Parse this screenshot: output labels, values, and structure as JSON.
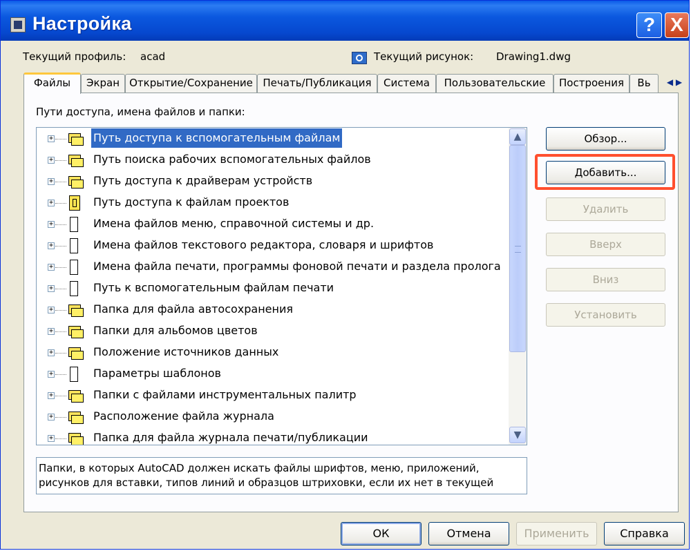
{
  "window": {
    "title": "Настройка",
    "help_label": "?",
    "close_label": "X"
  },
  "profile": {
    "current_profile_label": "Текущий профиль:",
    "current_profile_value": "acad",
    "current_drawing_label": "Текущий рисунок:",
    "current_drawing_value": "Drawing1.dwg"
  },
  "tabs": [
    {
      "label": "Файлы",
      "active": true
    },
    {
      "label": "Экран"
    },
    {
      "label": "Открытие/Сохранение"
    },
    {
      "label": "Печать/Публикация"
    },
    {
      "label": "Система"
    },
    {
      "label": "Пользовательские"
    },
    {
      "label": "Построения"
    },
    {
      "label": "Вь"
    }
  ],
  "tab_scroll": {
    "left": "◀",
    "right": "▶"
  },
  "files_panel": {
    "label": "Пути доступа, имена файлов и папки:",
    "tree_items": [
      {
        "label": "Путь доступа к вспомогательным файлам",
        "icon": "folder-icon",
        "selected": true
      },
      {
        "label": "Путь поиска рабочих вспомогательных файлов",
        "icon": "folder-icon"
      },
      {
        "label": "Путь доступа к драйверам устройств",
        "icon": "folder-icon"
      },
      {
        "label": "Путь доступа к файлам проектов",
        "icon": "project-icon"
      },
      {
        "label": "Имена файлов меню, справочной системы и др.",
        "icon": "document-icon"
      },
      {
        "label": "Имена файлов текстового редактора, словаря и шрифтов",
        "icon": "document-icon"
      },
      {
        "label": "Имена файла печати, программы фоновой печати и раздела пролога",
        "icon": "document-icon"
      },
      {
        "label": "Путь к вспомогательным файлам печати",
        "icon": "document-icon"
      },
      {
        "label": "Папка для файла автосохранения",
        "icon": "folder-icon"
      },
      {
        "label": "Папки для альбомов цветов",
        "icon": "folder-icon"
      },
      {
        "label": "Положение источников данных",
        "icon": "folder-icon"
      },
      {
        "label": "Параметры шаблонов",
        "icon": "document-icon"
      },
      {
        "label": "Папки с файлами инструментальных палитр",
        "icon": "folder-icon"
      },
      {
        "label": "Расположение файла журнала",
        "icon": "folder-icon"
      },
      {
        "label": "Папка для файла журнала печати/публикации",
        "icon": "folder-icon"
      }
    ],
    "expander_symbol": "+",
    "scroll_up": "▲",
    "scroll_down": "▼",
    "description": "Папки, в которых AutoCAD должен искать файлы шрифтов, меню, приложений, рисунков для вставки, типов линий и образцов штриховки, если их нет в текущей папке."
  },
  "side_buttons": {
    "browse": "Обзор...",
    "add": "Добавить...",
    "remove": "Удалить",
    "move_up": "Вверх",
    "move_down": "Вниз",
    "set_current": "Установить"
  },
  "bottom_buttons": {
    "ok": "ОК",
    "cancel": "Отмена",
    "apply": "Применить",
    "help": "Справка"
  },
  "colors": {
    "titlebar": "#0a5ae8",
    "selection": "#316ac5",
    "highlight_box": "#ff4f2e",
    "dialog_bg": "#ece9d8"
  }
}
